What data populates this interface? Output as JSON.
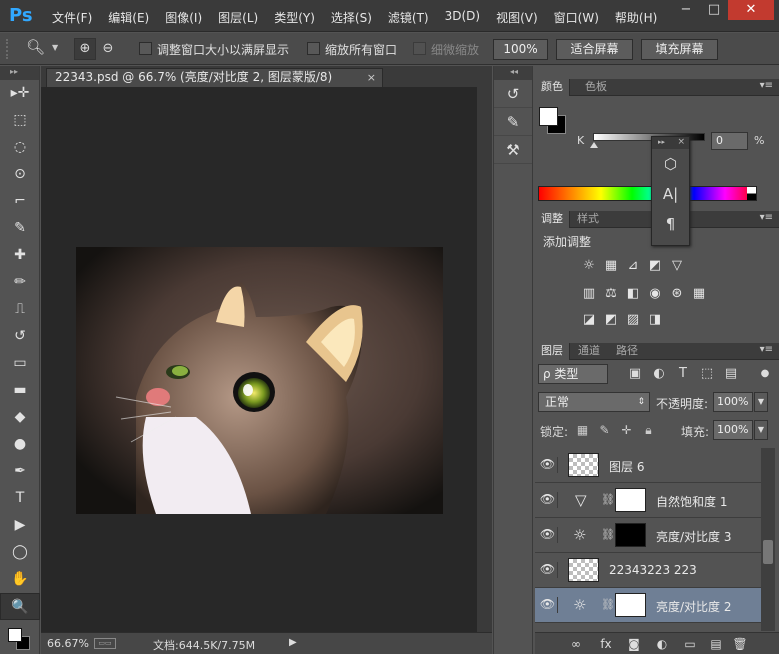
{
  "app": {
    "logo": "Ps"
  },
  "menu": [
    "文件(F)",
    "编辑(E)",
    "图像(I)",
    "图层(L)",
    "类型(Y)",
    "选择(S)",
    "滤镜(T)",
    "3D(D)",
    "视图(V)",
    "窗口(W)",
    "帮助(H)"
  ],
  "window_controls": {
    "minimize": "−",
    "maximize": "□",
    "close": "✕"
  },
  "options": {
    "tool_icon": "zoom-icon",
    "zoom_in": "⊕",
    "zoom_out": "⊖",
    "resize_windows": "调整窗口大小以满屏显示",
    "zoom_all": "缩放所有窗口",
    "scrubby_zoom": "细微缩放",
    "btn_100": "100%",
    "btn_fit": "适合屏幕",
    "btn_fill": "填充屏幕"
  },
  "document": {
    "tab_title": "22343.psd @ 66.7% (亮度/对比度 2, 图层蒙版/8)",
    "tab_close": "×",
    "status_zoom": "66.67%",
    "status_doc": "文档:644.5K/7.75M",
    "status_arrow": "▶"
  },
  "tools": [
    "move",
    "marquee",
    "lasso",
    "quick-select",
    "crop",
    "eyedropper",
    "healing",
    "brush",
    "stamp",
    "history-brush",
    "eraser",
    "gradient",
    "blur",
    "dodge",
    "pen",
    "type",
    "path-select",
    "shape",
    "hand",
    "zoom"
  ],
  "tool_glyphs": [
    "▸✛",
    "⬚",
    "◌",
    "⊙",
    "⌐",
    "✎",
    "✚",
    "✏",
    "⎍",
    "↺",
    "▭",
    "▬",
    "◆",
    "●",
    "✒",
    "T",
    "▶",
    "◯",
    "✋",
    "🔍"
  ],
  "color_panel": {
    "tab_color": "颜色",
    "tab_swatches": "色板",
    "k_label": "K",
    "k_value": "0",
    "pct": "%"
  },
  "adjust_panel": {
    "tab_adjust": "调整",
    "tab_styles": "样式",
    "title": "添加调整",
    "row1": [
      "☼",
      "▦",
      "⊿",
      "◩",
      "▽"
    ],
    "row2": [
      "▥",
      "⚖",
      "◧",
      "◉",
      "⊛",
      "▦"
    ],
    "row3": [
      "◪",
      "◩",
      "▨",
      "◨"
    ]
  },
  "float_panel": {
    "head": "▸▸",
    "close": "×",
    "btn1": "⬡",
    "btn2": "A|",
    "btn3": "¶"
  },
  "layers_panel": {
    "tab_layers": "图层",
    "tab_channels": "通道",
    "tab_paths": "路径",
    "filter_label": "ρ 类型",
    "blend_mode": "正常",
    "opacity_label": "不透明度:",
    "opacity_value": "100%",
    "lock_label": "锁定:",
    "fill_label": "填充:",
    "fill_value": "100%",
    "layers": [
      {
        "name": "图层 6",
        "kind": "pixel",
        "thumb": "checker",
        "selected": false
      },
      {
        "name": "自然饱和度 1",
        "kind": "vibrance",
        "thumb": "white",
        "selected": false
      },
      {
        "name": "亮度/对比度 3",
        "kind": "brightness",
        "thumb": "black",
        "selected": false
      },
      {
        "name": "22343223 223",
        "kind": "pixel",
        "thumb": "checker",
        "selected": false
      },
      {
        "name": "亮度/对比度 2",
        "kind": "brightness",
        "thumb": "white",
        "selected": true
      }
    ],
    "footer_icons": [
      "∞",
      "fx",
      "◙",
      "◐",
      "▭",
      "▤",
      "🗑"
    ]
  },
  "colors": {
    "selected_layer": "#6f7f95",
    "accent_logo": "#31a8ff",
    "close_red": "#c23a2f"
  }
}
